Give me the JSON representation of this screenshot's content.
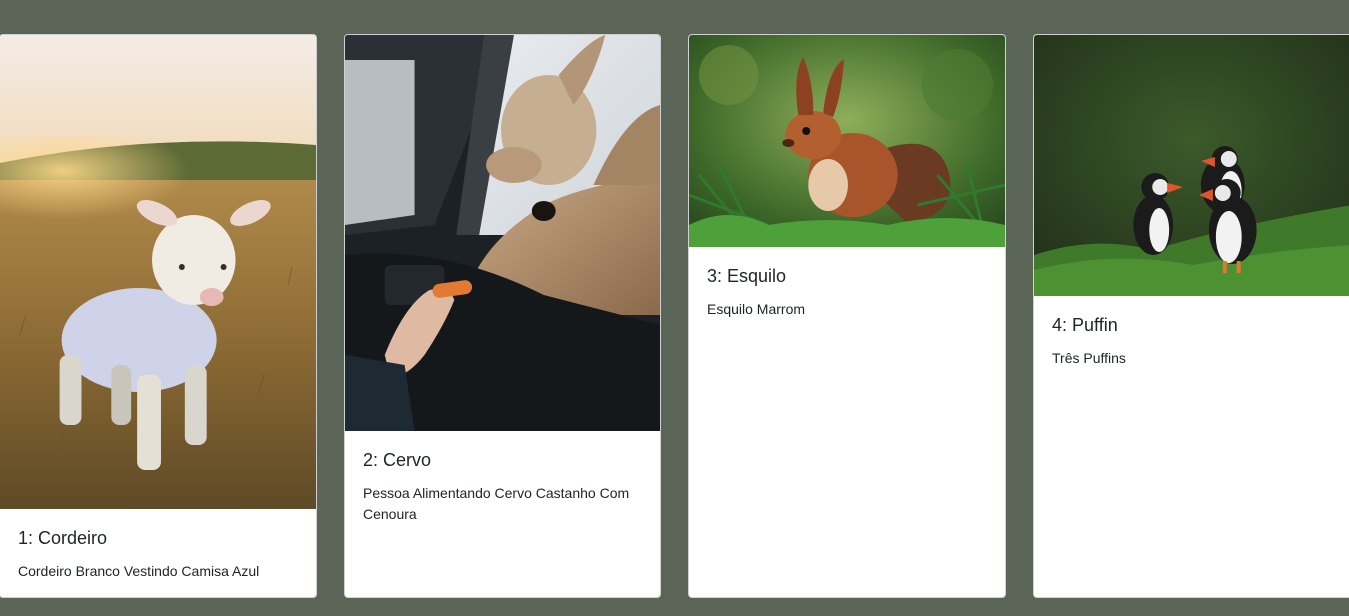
{
  "cards": [
    {
      "title": "1: Cordeiro",
      "text": "Cordeiro Branco Vestindo Camisa Azul",
      "image": "lamb-photo"
    },
    {
      "title": "2: Cervo",
      "text": "Pessoa Alimentando Cervo Castanho Com Cenoura",
      "image": "deer-photo"
    },
    {
      "title": "3: Esquilo",
      "text": "Esquilo Marrom",
      "image": "squirrel-photo"
    },
    {
      "title": "4: Puffin",
      "text": "Três Puffins",
      "image": "puffins-photo"
    }
  ],
  "colors": {
    "background": "#5a6558",
    "card": "#ffffff",
    "text": "#212529"
  }
}
